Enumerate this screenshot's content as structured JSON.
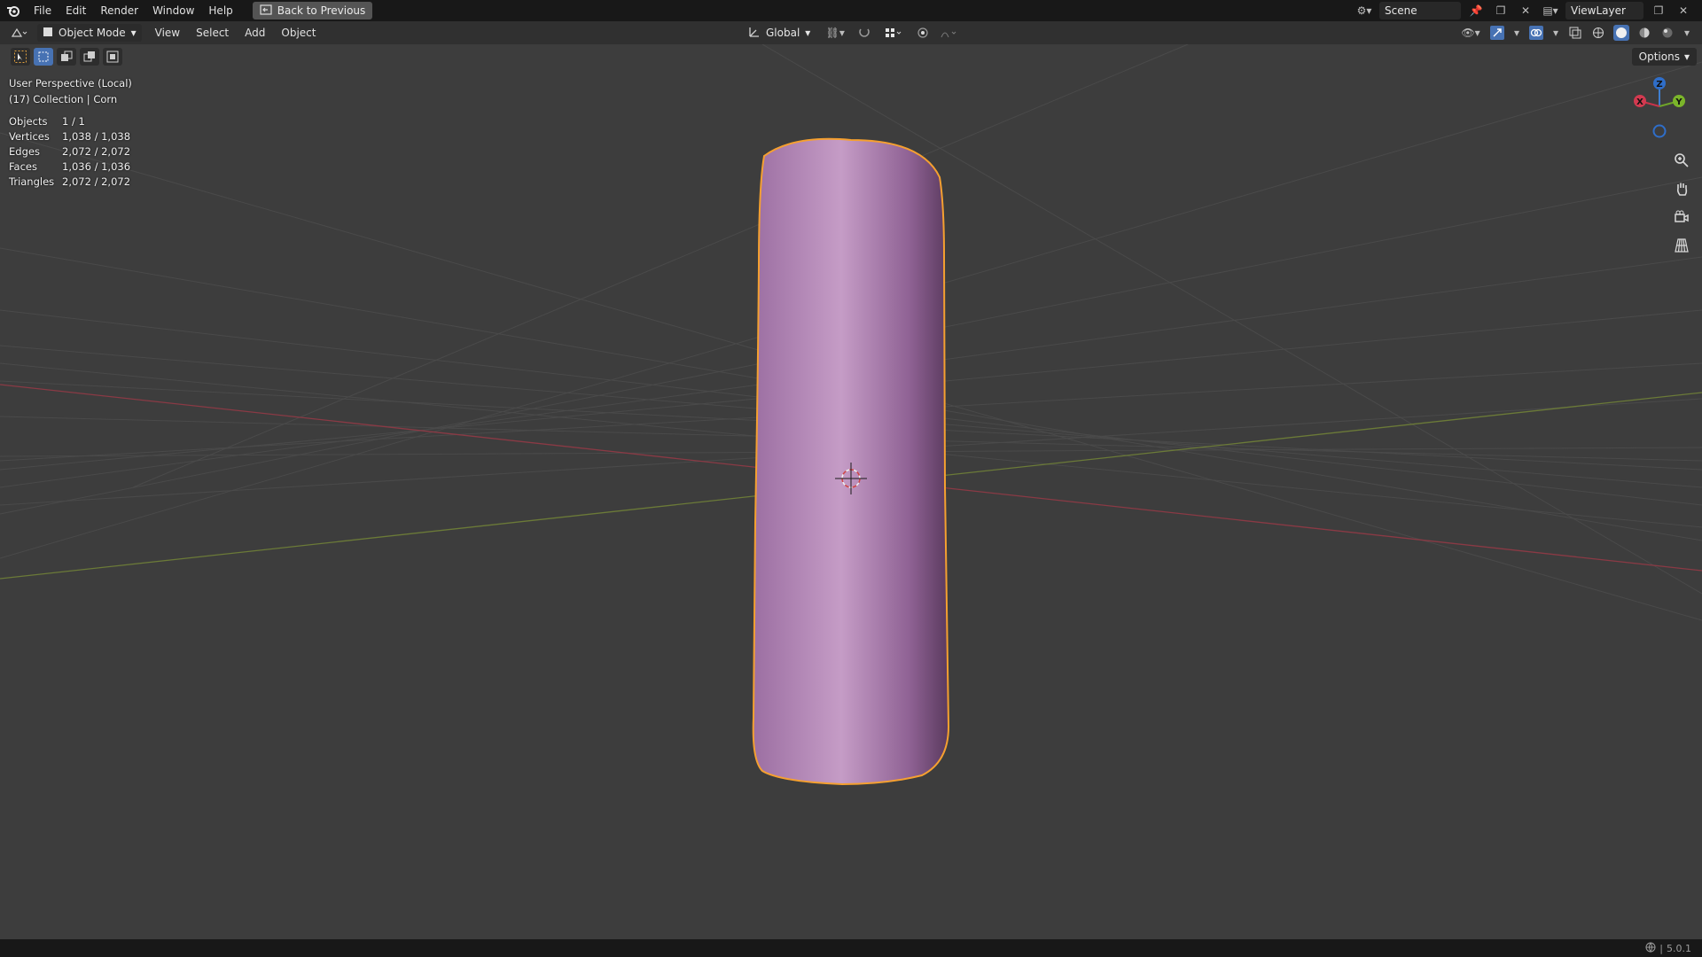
{
  "topbar": {
    "menus": [
      "File",
      "Edit",
      "Render",
      "Window",
      "Help"
    ],
    "back_label": "Back to Previous",
    "scene": "Scene",
    "view_layer": "ViewLayer"
  },
  "header": {
    "mode": "Object Mode",
    "menus": [
      "View",
      "Select",
      "Add",
      "Object"
    ],
    "orientation": "Global"
  },
  "viewport": {
    "options_label": "Options",
    "view_name": "User Perspective (Local)",
    "collection": "(17) Collection | Corn",
    "stats": [
      {
        "label": "Objects",
        "value": "1 / 1"
      },
      {
        "label": "Vertices",
        "value": "1,038 / 1,038"
      },
      {
        "label": "Edges",
        "value": "2,072 / 2,072"
      },
      {
        "label": "Faces",
        "value": "1,036 / 1,036"
      },
      {
        "label": "Triangles",
        "value": "2,072 / 2,072"
      }
    ],
    "gizmo": {
      "x": "X",
      "y": "Y",
      "z": "Z"
    },
    "object_color": "#b58ab9",
    "selection_color": "#f5a030"
  },
  "status": {
    "version": "5.0.1"
  }
}
